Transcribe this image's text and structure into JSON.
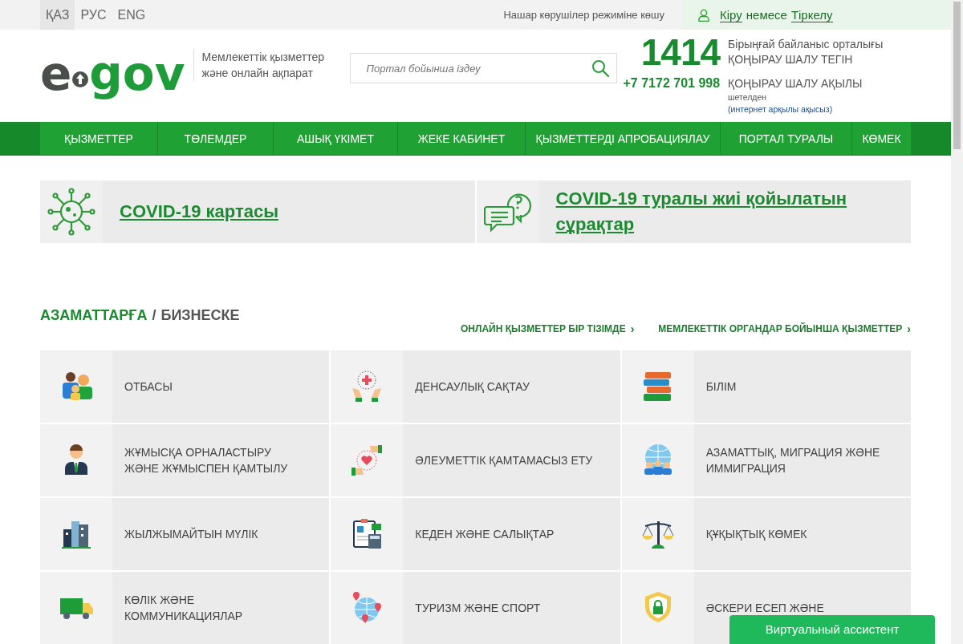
{
  "top_bar": {
    "languages": [
      {
        "label": "ҚАЗ",
        "selected": true
      },
      {
        "label": "РУС",
        "selected": false
      },
      {
        "label": "ENG",
        "selected": false
      }
    ],
    "accessibility_link": "Нашар көрушілер режиміне көшу",
    "login": {
      "sign_in": "Кіру",
      "separator": "немесе",
      "register": "Тіркелу"
    }
  },
  "header": {
    "logo": {
      "left": "e",
      "right": "gov"
    },
    "tagline": "Мемлекеттік қызметтер және онлайн ақпарат",
    "search": {
      "placeholder": "Портал бойынша іздеу"
    },
    "contact": {
      "short_number": "1414",
      "center": "Бірыңғай байланыс орталығы",
      "free_call": "ҚОҢЫРАУ ШАЛУ ТЕГІН",
      "phone": "+7 7172 701 998",
      "paid_call": "ҚОҢЫРАУ ШАЛУ АҚЫЛЫ",
      "abroad": "шетелден",
      "internet_note": "(интернет арқылы ақысыз)"
    }
  },
  "nav": [
    "ҚЫЗМЕТТЕР",
    "ТӨЛЕМДЕР",
    "АШЫҚ ҮКІМЕТ",
    "ЖЕКЕ КАБИНЕТ",
    "ҚЫЗМЕТТЕРДІ АПРОБАЦИЯЛАУ",
    "ПОРТАЛ ТУРАЛЫ",
    "КӨМЕК"
  ],
  "covid_banners": [
    {
      "kind": "virus",
      "title": "COVID-19 картасы"
    },
    {
      "kind": "chat",
      "title": "COVID-19 туралы жиі қойылатын сұрақтар"
    }
  ],
  "audience_tabs": [
    {
      "label": "АЗАМАТТАРҒА",
      "selected": true
    },
    {
      "label": "БИЗНЕСКЕ",
      "selected": false
    }
  ],
  "audience_separator": "/",
  "links": [
    {
      "label": "ОНЛАЙН ҚЫЗМЕТТЕР БІР ТІЗІМДЕ",
      "arrow": "›"
    },
    {
      "label": "МЕМЛЕКЕТТІК ОРГАНДАР БОЙЫНША ҚЫЗМЕТТЕР",
      "arrow": "›"
    }
  ],
  "categories": [
    {
      "kind": "family",
      "label": "ОТБАСЫ"
    },
    {
      "kind": "health",
      "label": "ДЕНСАУЛЫҚ САҚТАУ"
    },
    {
      "kind": "books",
      "label": "БІЛІМ"
    },
    {
      "kind": "worker",
      "label": "ЖҰМЫСҚА ОРНАЛАСТЫРУ ЖӘНЕ ЖҰМЫСПЕН ҚАМТЫЛУ"
    },
    {
      "kind": "care",
      "label": "ӘЛЕУМЕТТІК ҚАМТАМАСЫЗ ЕТУ"
    },
    {
      "kind": "globe-people",
      "label": "АЗАМАТТЫҚ, МИГРАЦИЯ ЖӘНЕ ИММИГРАЦИЯ"
    },
    {
      "kind": "buildings",
      "label": "ЖЫЛЖЫМАЙТЫН МҮЛІК"
    },
    {
      "kind": "calculator",
      "label": "КЕДЕН ЖӘНЕ САЛЫҚТАР"
    },
    {
      "kind": "scales",
      "label": "ҚҰҚЫҚТЫҚ КӨМЕК"
    },
    {
      "kind": "truck",
      "label": "КӨЛІК ЖӘНЕ КОММУНИКАЦИЯЛАР"
    },
    {
      "kind": "globe-pins",
      "label": "ТУРИЗМ ЖӘНЕ СПОРТ"
    },
    {
      "kind": "shield",
      "label": "ӘСКЕРИ ЕСЕП ЖӘНЕ"
    }
  ],
  "assistant_button": "Виртуальный ассистент"
}
